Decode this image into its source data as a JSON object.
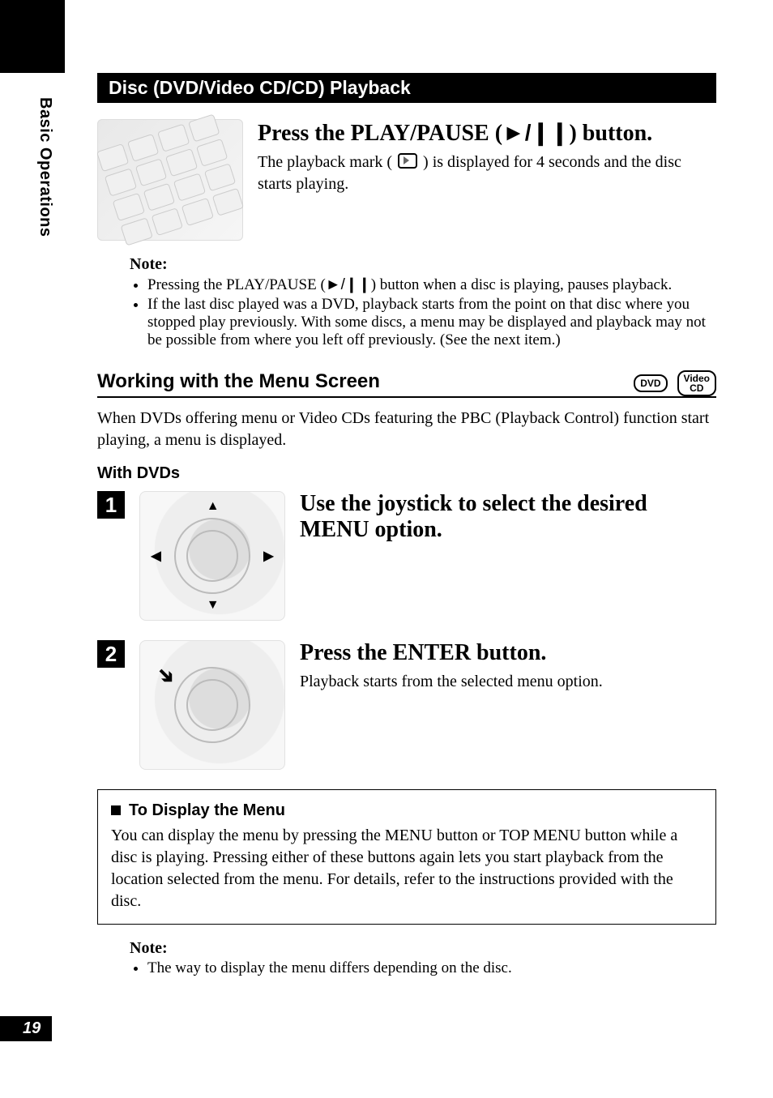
{
  "sideLabel": "Basic Operations",
  "sectionBar": "Disc (DVD/Video CD/CD) Playback",
  "intro": {
    "title_a": "Press the PLAY/PAUSE (",
    "title_b": ") button.",
    "body_a": "The playback mark (",
    "body_b": ") is displayed for 4 seconds and the disc starts playing."
  },
  "playPauseGlyph": "►/❙❙",
  "note1": {
    "label": "Note:",
    "items": [
      {
        "a": "Pressing the PLAY/PAUSE (",
        "b": ") button when a disc is playing, pauses playback."
      },
      {
        "a": "If the last disc played was a DVD, playback starts from the point on that disc where you stopped play previously. With some discs, a menu may be displayed and playback may not be possible from where you left off previously. (See the next item.)",
        "b": ""
      }
    ]
  },
  "menuSection": {
    "heading": "Working with the Menu Screen",
    "badges": {
      "dvd": "DVD",
      "vcd_top": "Video",
      "vcd_bottom": "CD"
    },
    "intro": "When DVDs offering menu or Video CDs featuring the PBC (Playback Control) function start playing, a menu is displayed.",
    "withDvds": "With DVDs",
    "steps": [
      {
        "num": "1",
        "title": "Use the joystick to select the desired MENU option.",
        "body": ""
      },
      {
        "num": "2",
        "title": "Press the ENTER button.",
        "body": "Playback starts from the selected menu option."
      }
    ]
  },
  "tip": {
    "title": "To Display the Menu",
    "body": "You can display the menu by pressing the MENU button or TOP MENU button while a disc is playing. Pressing either of these buttons again lets you start playback from the location selected from the menu. For details, refer to the instructions provided with the disc."
  },
  "note2": {
    "label": "Note:",
    "items": [
      "The way to display the menu differs depending on the disc."
    ]
  },
  "pageNumber": "19"
}
